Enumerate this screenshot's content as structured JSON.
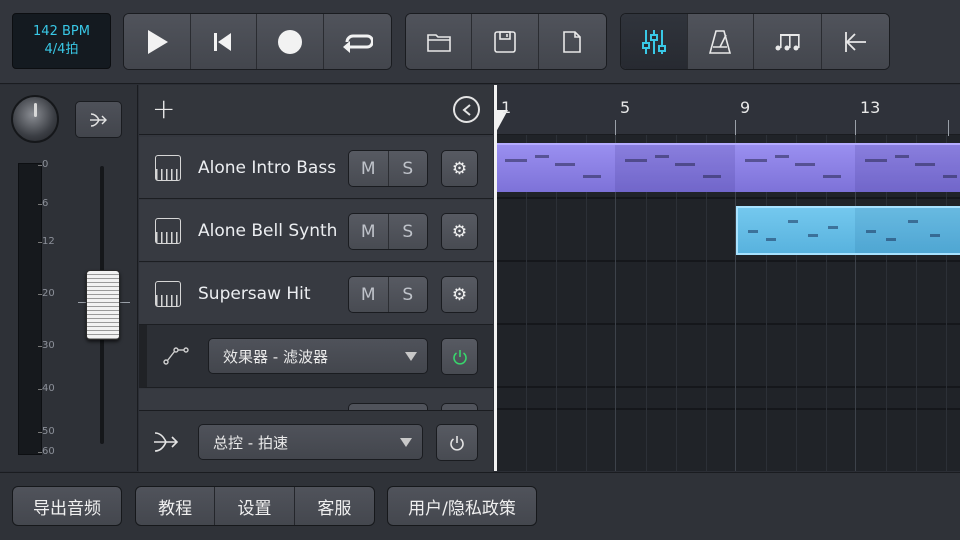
{
  "transport": {
    "bpm": "142 BPM",
    "time_signature": "4/4拍"
  },
  "toolbar": {
    "transport_icons": [
      "play-icon",
      "skip-to-start-icon",
      "record-icon",
      "loop-icon"
    ],
    "file_icons": [
      "folder-icon",
      "save-icon",
      "new-file-icon"
    ],
    "view_icons": [
      "mixer-icon",
      "metronome-icon",
      "music-notes-icon",
      "back-to-start-icon"
    ],
    "active_view": "mixer-icon",
    "accent_color": "#39c8e6"
  },
  "master_meter": {
    "ticks": [
      "0",
      "6",
      "12",
      "20",
      "30",
      "40",
      "50",
      "60"
    ]
  },
  "tracks": [
    {
      "name": "Alone Intro Bass",
      "mute_label": "M",
      "solo_label": "S",
      "icon": "synth-instrument-icon"
    },
    {
      "name": "Alone Bell Synth",
      "mute_label": "M",
      "solo_label": "S",
      "icon": "piano-instrument-icon"
    },
    {
      "name": "Supersaw Hit",
      "mute_label": "M",
      "solo_label": "S",
      "icon": "piano-instrument-icon"
    }
  ],
  "effect_row": {
    "selected": "效果器 - 滤波器",
    "power": "on"
  },
  "master_row": {
    "selected": "总控 - 拍速"
  },
  "ruler": {
    "bars": [
      "1",
      "5",
      "9",
      "13"
    ]
  },
  "clips": {
    "purple_color": "#8a80e6",
    "blue_color": "#65bde6"
  },
  "bottom": {
    "export_label": "导出音频",
    "tutorial_label": "教程",
    "settings_label": "设置",
    "support_label": "客服",
    "privacy_label": "用户/隐私政策"
  }
}
